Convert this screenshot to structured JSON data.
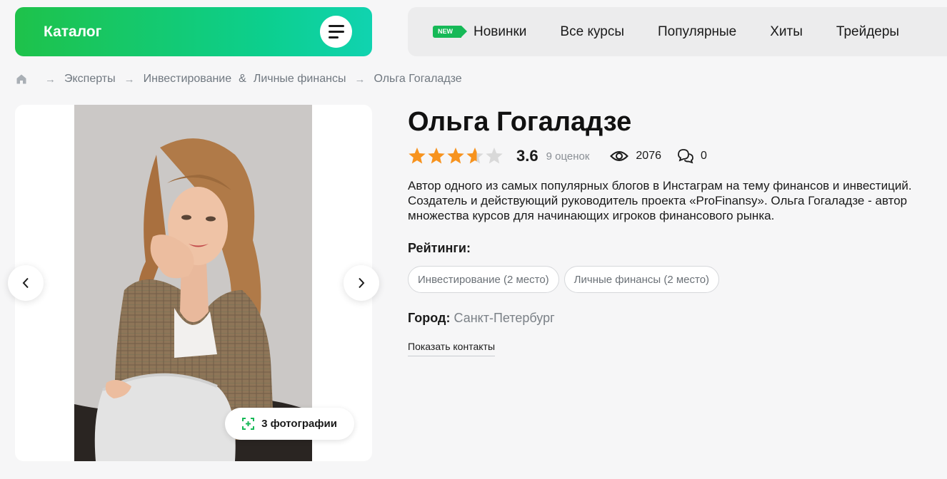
{
  "header": {
    "catalog_label": "Каталог",
    "new_badge": "NEW",
    "nav": [
      "Новинки",
      "Все курсы",
      "Популярные",
      "Хиты",
      "Трейдеры"
    ]
  },
  "breadcrumb": {
    "items": [
      "Эксперты",
      "Инвестирование",
      "&",
      "Личные финансы",
      "Ольга Гогаладзе"
    ]
  },
  "gallery": {
    "photos_label": "3 фотографии"
  },
  "expert": {
    "name": "Ольга Гогаладзе",
    "rating": "3.6",
    "rating_fraction": 0.72,
    "rating_count": "9 оценок",
    "views": "2076",
    "comments": "0",
    "description": "Автор одного из самых популярных блогов в Инстаграм на тему финансов и инвестиций. Создатель и действующий руководитель проекта «ProFinansy». Ольга Гогаладзе - автор множества курсов для начинающих игроков финансового рынка.",
    "ratings_title": "Рейтинги:",
    "tags": [
      "Инвестирование (2 место)",
      "Личные финансы (2 место)"
    ],
    "city_label": "Город:",
    "city": "Санкт-Петербург",
    "contacts_link": "Показать контакты"
  },
  "colors": {
    "accent_green": "#16b957",
    "star_orange": "#f7931e",
    "star_gray": "#d9d9d9"
  }
}
